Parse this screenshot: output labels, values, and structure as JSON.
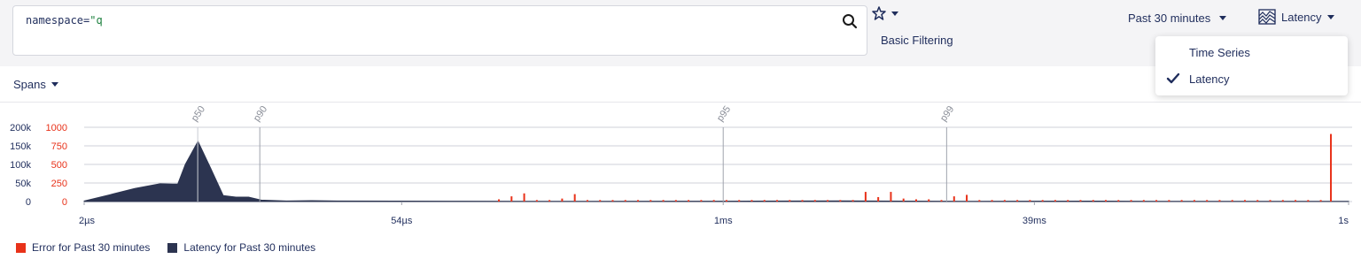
{
  "query": {
    "key": "namespace=",
    "value": "\"q"
  },
  "toolbar": {
    "basic_filtering": "Basic Filtering",
    "time_range": "Past 30 minutes",
    "view": "Latency"
  },
  "dropdown": {
    "items": [
      {
        "label": "Time Series",
        "checked": false
      },
      {
        "label": "Latency",
        "checked": true
      }
    ]
  },
  "spans_label": "Spans",
  "legend": {
    "error": "Error for Past 30 minutes",
    "latency": "Latency for Past 30 minutes"
  },
  "colors": {
    "error": "#e8321a",
    "latency": "#2c3450",
    "accent": "#1f2d5c"
  },
  "chart_data": {
    "type": "area",
    "x_tick_labels": [
      "2µs",
      "54µs",
      "1ms",
      "39ms",
      "1s"
    ],
    "y_left_ticks": [
      "200k",
      "150k",
      "100k",
      "50k",
      "0"
    ],
    "y_right_ticks": [
      "1000",
      "750",
      "500",
      "250",
      "0"
    ],
    "ylim_left": [
      0,
      200000
    ],
    "ylim_right": [
      0,
      1000
    ],
    "percentile_markers": [
      "p50",
      "p90",
      "p95",
      "p99"
    ],
    "series": [
      {
        "name": "Latency for Past 30 minutes",
        "points": [
          [
            0,
            1500
          ],
          [
            0.02,
            18000
          ],
          [
            0.04,
            35000
          ],
          [
            0.06,
            48000
          ],
          [
            0.07,
            47000
          ],
          [
            0.074,
            47000
          ],
          [
            0.08,
            100000
          ],
          [
            0.09,
            162000
          ],
          [
            0.1,
            90000
          ],
          [
            0.11,
            16000
          ],
          [
            0.12,
            12000
          ],
          [
            0.13,
            12000
          ],
          [
            0.14,
            4000
          ],
          [
            0.16,
            1500
          ],
          [
            0.18,
            2500
          ],
          [
            0.2,
            1500
          ],
          [
            0.3,
            800
          ],
          [
            0.35,
            700
          ],
          [
            0.4,
            600
          ],
          [
            0.5,
            900
          ],
          [
            0.6,
            1800
          ],
          [
            0.7,
            700
          ],
          [
            0.8,
            1200
          ],
          [
            0.85,
            600
          ],
          [
            0.9,
            700
          ],
          [
            0.95,
            500
          ],
          [
            1.0,
            500
          ]
        ]
      },
      {
        "name": "Error for Past 30 minutes",
        "points": [
          [
            0.328,
            30
          ],
          [
            0.338,
            70
          ],
          [
            0.348,
            110
          ],
          [
            0.358,
            20
          ],
          [
            0.368,
            20
          ],
          [
            0.378,
            40
          ],
          [
            0.388,
            100
          ],
          [
            0.398,
            20
          ],
          [
            0.408,
            20
          ],
          [
            0.418,
            20
          ],
          [
            0.428,
            20
          ],
          [
            0.438,
            20
          ],
          [
            0.448,
            20
          ],
          [
            0.458,
            20
          ],
          [
            0.468,
            20
          ],
          [
            0.478,
            20
          ],
          [
            0.488,
            20
          ],
          [
            0.498,
            20
          ],
          [
            0.508,
            20
          ],
          [
            0.518,
            20
          ],
          [
            0.528,
            20
          ],
          [
            0.538,
            20
          ],
          [
            0.548,
            20
          ],
          [
            0.558,
            20
          ],
          [
            0.568,
            20
          ],
          [
            0.578,
            20
          ],
          [
            0.588,
            20
          ],
          [
            0.598,
            20
          ],
          [
            0.608,
            20
          ],
          [
            0.618,
            130
          ],
          [
            0.628,
            60
          ],
          [
            0.638,
            130
          ],
          [
            0.648,
            40
          ],
          [
            0.658,
            30
          ],
          [
            0.668,
            30
          ],
          [
            0.678,
            20
          ],
          [
            0.688,
            70
          ],
          [
            0.698,
            90
          ],
          [
            0.708,
            20
          ],
          [
            0.718,
            20
          ],
          [
            0.728,
            20
          ],
          [
            0.738,
            20
          ],
          [
            0.748,
            20
          ],
          [
            0.758,
            20
          ],
          [
            0.768,
            20
          ],
          [
            0.778,
            20
          ],
          [
            0.788,
            20
          ],
          [
            0.798,
            20
          ],
          [
            0.808,
            20
          ],
          [
            0.818,
            20
          ],
          [
            0.828,
            20
          ],
          [
            0.838,
            20
          ],
          [
            0.848,
            20
          ],
          [
            0.858,
            20
          ],
          [
            0.868,
            20
          ],
          [
            0.878,
            20
          ],
          [
            0.888,
            20
          ],
          [
            0.898,
            20
          ],
          [
            0.908,
            20
          ],
          [
            0.918,
            20
          ],
          [
            0.928,
            20
          ],
          [
            0.938,
            20
          ],
          [
            0.948,
            20
          ],
          [
            0.958,
            20
          ],
          [
            0.968,
            20
          ],
          [
            0.978,
            20
          ],
          [
            0.986,
            910
          ]
        ]
      }
    ],
    "grid": true
  }
}
